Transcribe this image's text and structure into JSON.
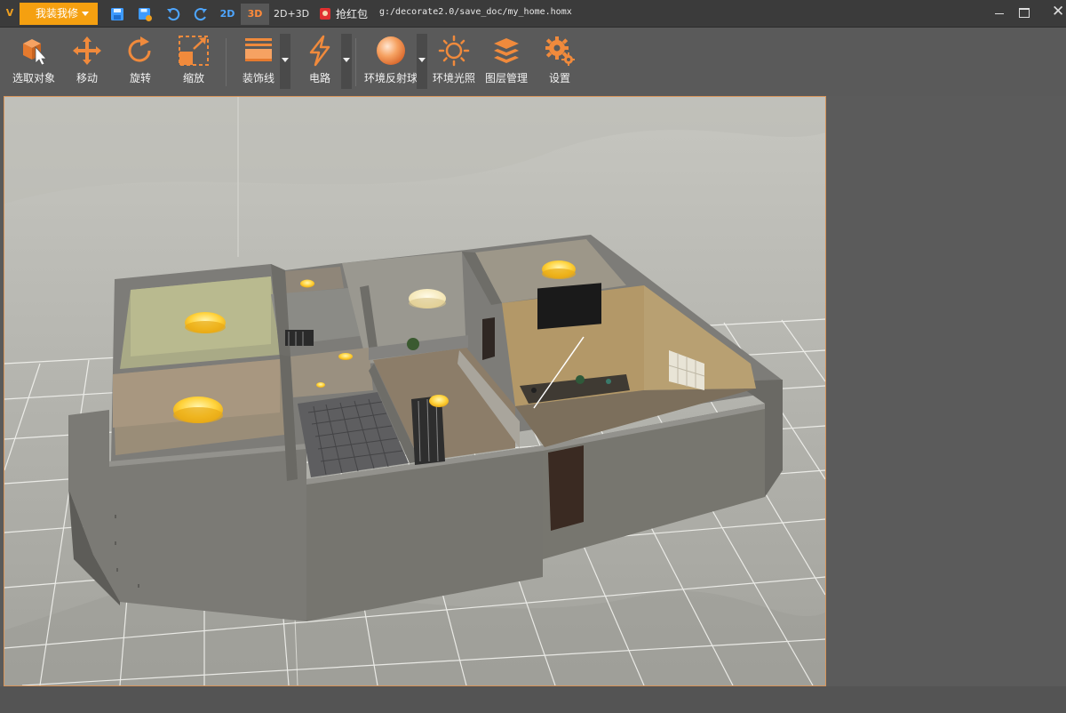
{
  "titlebar": {
    "app_logo": "V",
    "menu_label": "我装我修",
    "quick_actions": [
      "save-icon",
      "save-as-icon",
      "undo-icon",
      "redo-icon"
    ],
    "modes": {
      "m2d": "2D",
      "m3d": "3D",
      "m23": "2D+3D",
      "active": "3D"
    },
    "red_packet_label": "抢红包",
    "file_path": "g:/decorate2.0/save_doc/my_home.homx",
    "close_glyph": "✕"
  },
  "toolbar": {
    "select": "选取对象",
    "move": "移动",
    "rotate": "旋转",
    "scale": "缩放",
    "molding": "装饰线",
    "circuit": "电路",
    "env_sphere": "环境反射球",
    "env_light": "环境光照",
    "layers": "图层管理",
    "settings": "设置"
  },
  "colors": {
    "accent": "#f5a010",
    "icon_orange": "#f08a3c",
    "mode_2d": "#4ea6ff",
    "mode_3d": "#ff8a3a",
    "viewport_border": "#d7955b"
  }
}
